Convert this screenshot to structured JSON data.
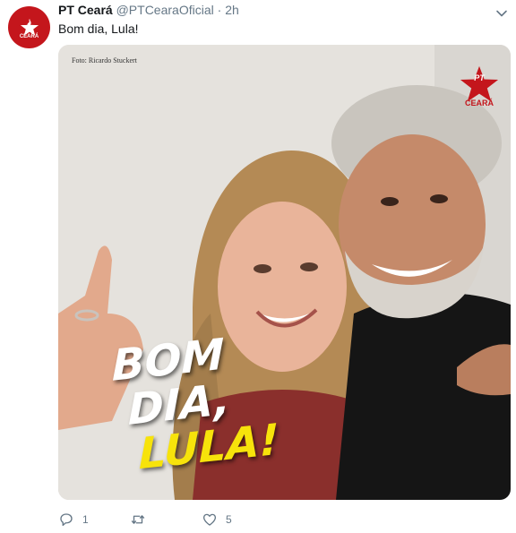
{
  "tweet": {
    "author_name": "PT Ceará",
    "handle": "@PTCearaOficial",
    "separator": "·",
    "time": "2h",
    "text": "Bom dia, Lula!",
    "avatar_logo_text": "PT",
    "avatar_state_text": "CEARÁ",
    "image": {
      "photo_credit": "Foto: Ricardo Stuckert",
      "brand_pt": "PT",
      "brand_state": "CEARÁ",
      "headline_line1": "BOM",
      "headline_line2": "DIA,",
      "headline_line3": "LULA!"
    },
    "actions": {
      "reply_count": "1",
      "retweet_count": "",
      "like_count": "5"
    }
  },
  "colors": {
    "brand_red": "#c4161c",
    "headline_yellow": "#f7e30b",
    "meta_gray": "#657786"
  }
}
